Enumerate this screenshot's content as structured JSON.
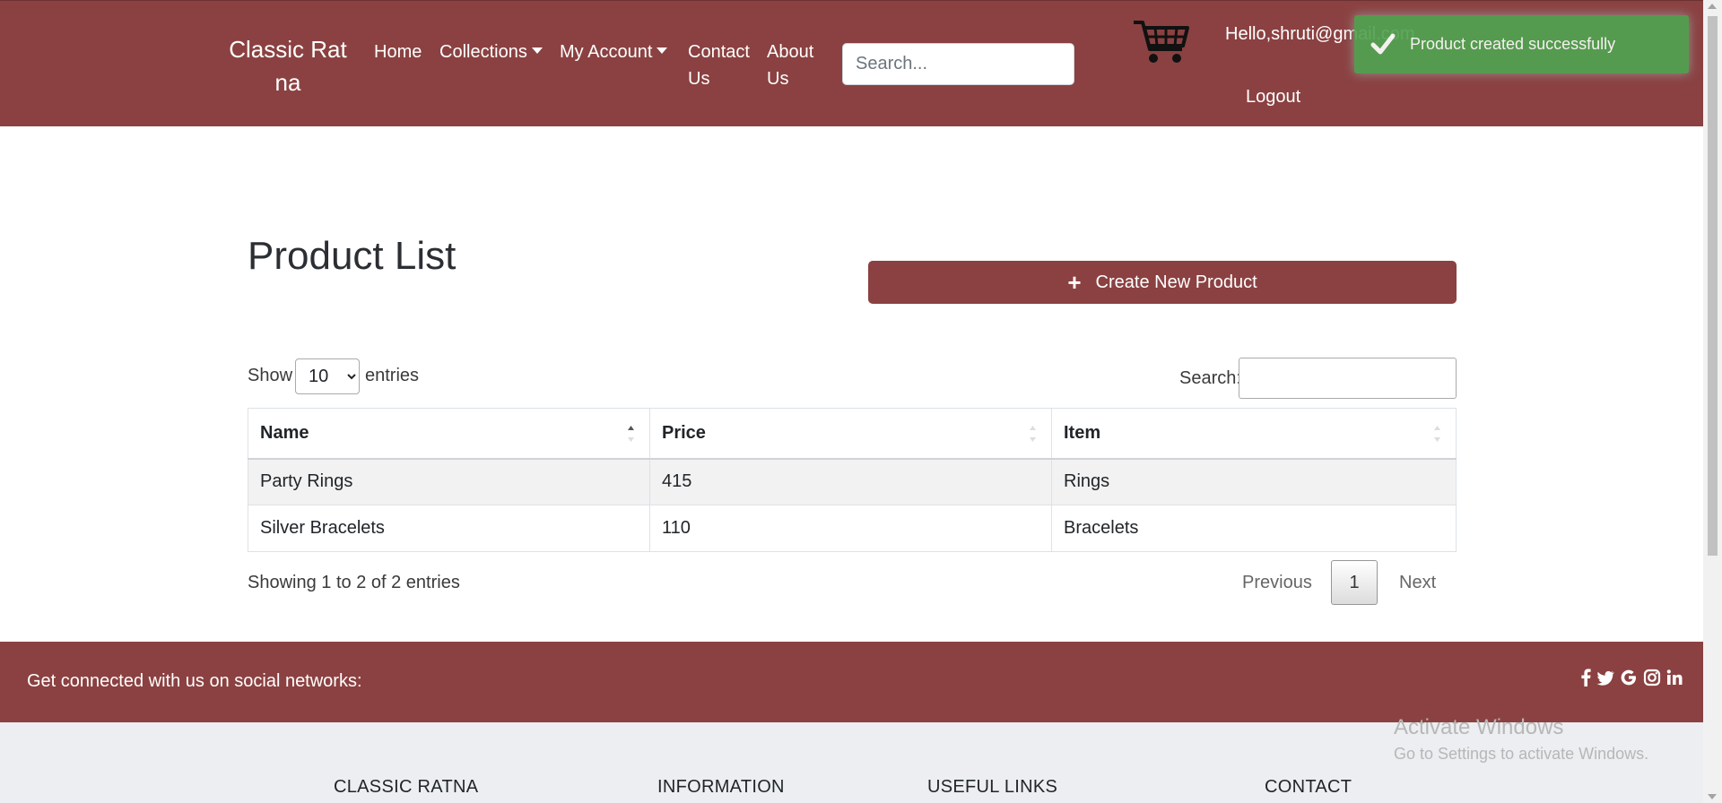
{
  "nav": {
    "brand": "Classic Ratna",
    "home": "Home",
    "collections": "Collections",
    "my_account": "My Account",
    "contact": "Contact Us",
    "about": "About Us",
    "search_placeholder": "Search...",
    "greeting": "Hello,shruti@gmail.com",
    "logout": "Logout",
    "cart_icon": "shopping-cart-icon"
  },
  "toast": {
    "message": "Product created successfully",
    "icon": "checkmark-icon",
    "color": "#51a351"
  },
  "main": {
    "title": "Product List",
    "create_button": "Create New Product",
    "create_icon": "plus-icon"
  },
  "table_controls": {
    "show_label": "Show",
    "page_size": "10",
    "entries_label": "entries",
    "search_label": "Search:"
  },
  "table": {
    "columns": [
      "Name",
      "Price",
      "Item"
    ],
    "rows": [
      [
        "Party Rings",
        "415",
        "Rings"
      ],
      [
        "Silver Bracelets",
        "110",
        "Bracelets"
      ]
    ]
  },
  "pagination": {
    "info": "Showing 1 to 2 of 2 entries",
    "previous": "Previous",
    "current_page": "1",
    "next": "Next"
  },
  "footer": {
    "social_text": "Get connected with us on social networks:",
    "social_icons": [
      "facebook-icon",
      "twitter-icon",
      "google-icon",
      "instagram-icon",
      "linkedin-icon"
    ],
    "headings": [
      "CLASSIC RATNA",
      "INFORMATION",
      "USEFUL LINKS",
      "CONTACT"
    ]
  },
  "watermark": {
    "title": "Activate Windows",
    "subtitle": "Go to Settings to activate Windows."
  },
  "colors": {
    "brand": "#8b4141",
    "footer_bg": "#eceef1",
    "toast": "#51a351"
  }
}
